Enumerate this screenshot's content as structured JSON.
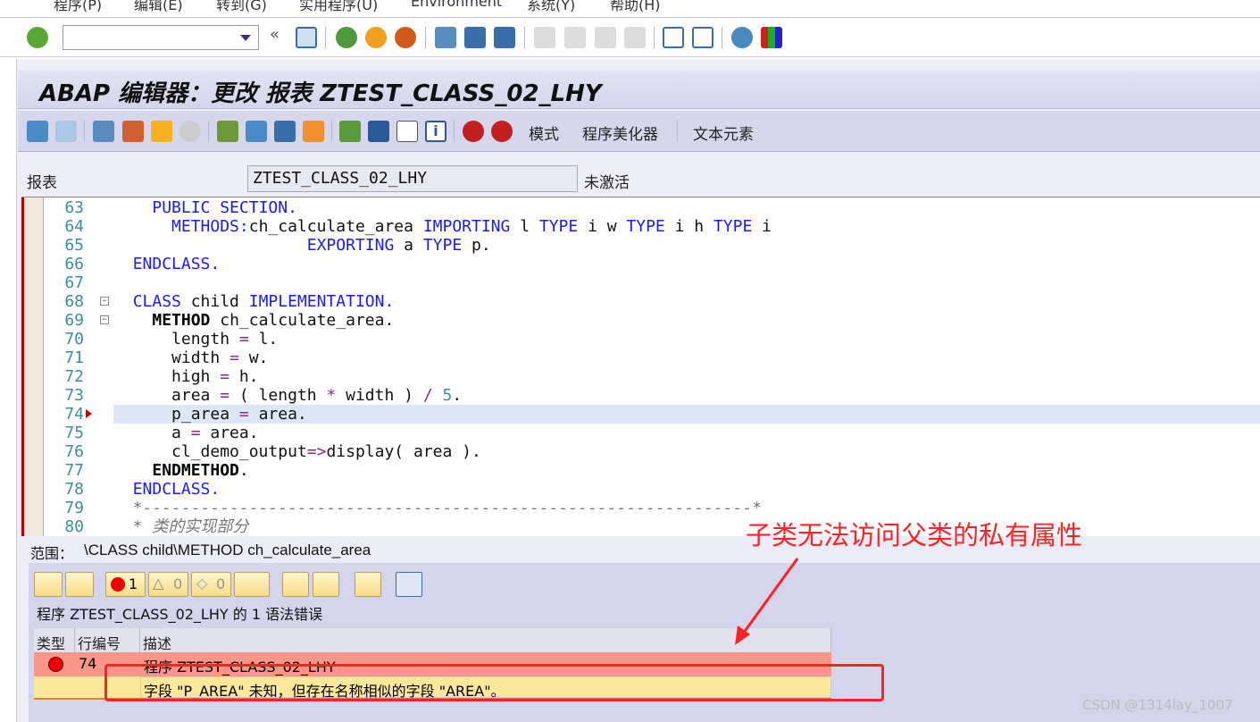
{
  "menu": [
    "程序(P)",
    "编辑(E)",
    "转到(G)",
    "实用程序(U)",
    "Environment",
    "系统(Y)",
    "帮助(H)"
  ],
  "toolbar": {
    "command_value": "",
    "icons": [
      "check-icon",
      "save-icon",
      "back-icon",
      "exit-icon",
      "cancel-icon",
      "print-icon",
      "find-icon",
      "find-next-icon",
      "first-page-icon",
      "prev-page-icon",
      "next-page-icon",
      "last-page-icon",
      "new-session-icon",
      "shortcut-icon",
      "help-icon",
      "layout-icon"
    ]
  },
  "title": "ABAP 编辑器：更改 报表 ZTEST_CLASS_02_LHY",
  "app_toolbar": {
    "mode": "模式",
    "pretty_printer": "程序美化器",
    "text_elements": "文本元素"
  },
  "report": {
    "label": "报表",
    "value": "ZTEST_CLASS_02_LHY",
    "status": "未激活"
  },
  "code": [
    {
      "n": "63",
      "t": [
        [
          "    ",
          ""
        ],
        [
          "PUBLIC SECTION",
          "kw"
        ],
        [
          ".",
          "kw"
        ]
      ]
    },
    {
      "n": "64",
      "t": [
        [
          "      ",
          ""
        ],
        [
          "METHODS",
          "kw"
        ],
        [
          ":",
          "kw"
        ],
        [
          "ch_calculate_area ",
          ""
        ],
        [
          "IMPORTING",
          "kw"
        ],
        [
          " l ",
          ""
        ],
        [
          "TYPE",
          "kw"
        ],
        [
          " i w ",
          ""
        ],
        [
          "TYPE",
          "kw"
        ],
        [
          " i h ",
          ""
        ],
        [
          "TYPE",
          "kw"
        ],
        [
          " i",
          ""
        ]
      ]
    },
    {
      "n": "65",
      "t": [
        [
          "                    ",
          ""
        ],
        [
          "EXPORTING",
          "kw"
        ],
        [
          " a ",
          ""
        ],
        [
          "TYPE",
          "kw"
        ],
        [
          " p.",
          ""
        ]
      ]
    },
    {
      "n": "66",
      "t": [
        [
          "  ",
          ""
        ],
        [
          "ENDCLASS",
          "kw"
        ],
        [
          ".",
          "kw"
        ]
      ]
    },
    {
      "n": "67",
      "t": []
    },
    {
      "n": "68",
      "t": [
        [
          "  ",
          ""
        ],
        [
          "CLASS",
          "kw"
        ],
        [
          " child ",
          ""
        ],
        [
          "IMPLEMENTATION",
          "kw"
        ],
        [
          ".",
          "kw"
        ]
      ]
    },
    {
      "n": "69",
      "t": [
        [
          "    ",
          ""
        ],
        [
          "METHOD",
          "kwb"
        ],
        [
          " ch_calculate_area.",
          ""
        ]
      ]
    },
    {
      "n": "70",
      "t": [
        [
          "      length ",
          ""
        ],
        [
          "=",
          "op"
        ],
        [
          " l.",
          ""
        ]
      ]
    },
    {
      "n": "71",
      "t": [
        [
          "      width ",
          ""
        ],
        [
          "=",
          "op"
        ],
        [
          " w.",
          ""
        ]
      ]
    },
    {
      "n": "72",
      "t": [
        [
          "      high ",
          ""
        ],
        [
          "=",
          "op"
        ],
        [
          " h.",
          ""
        ]
      ]
    },
    {
      "n": "73",
      "t": [
        [
          "      area ",
          ""
        ],
        [
          "=",
          "op"
        ],
        [
          " ( length ",
          ""
        ],
        [
          "*",
          "op"
        ],
        [
          " width ) ",
          ""
        ],
        [
          "/",
          "op"
        ],
        [
          " ",
          ""
        ],
        [
          "5",
          "num2"
        ],
        [
          ".",
          ""
        ]
      ]
    },
    {
      "n": "74",
      "t": [
        [
          "      p_area ",
          ""
        ],
        [
          "=",
          "op"
        ],
        [
          " area.",
          ""
        ]
      ]
    },
    {
      "n": "75",
      "t": [
        [
          "      a ",
          ""
        ],
        [
          "=",
          "op"
        ],
        [
          " area.",
          ""
        ]
      ]
    },
    {
      "n": "76",
      "t": [
        [
          "      cl_demo_output",
          ""
        ],
        [
          "=>",
          "op"
        ],
        [
          "display( area ).",
          ""
        ]
      ]
    },
    {
      "n": "77",
      "t": [
        [
          "    ",
          ""
        ],
        [
          "ENDMETHOD",
          "kwb"
        ],
        [
          ".",
          ""
        ]
      ]
    },
    {
      "n": "78",
      "t": [
        [
          "  ",
          ""
        ],
        [
          "ENDCLASS",
          "kw"
        ],
        [
          ".",
          "kw"
        ]
      ]
    },
    {
      "n": "79",
      "t": [
        [
          "  *---------------------------------------------------------------*",
          "cm"
        ]
      ]
    },
    {
      "n": "80",
      "t": [
        [
          "  * 类的实现部分",
          "cm"
        ]
      ]
    }
  ],
  "scope": {
    "label": "范围：",
    "value": "\\CLASS child\\METHOD ch_calculate_area"
  },
  "errors": {
    "error_count": "1",
    "warning_count": "0",
    "info_count": "0",
    "summary": "程序 ZTEST_CLASS_02_LHY 的 1 语法错误",
    "headers": [
      "类型",
      "行编号",
      "描述"
    ],
    "row": {
      "line": "74",
      "program": "程序 ZTEST_CLASS_02_LHY",
      "message": "字段 \"P_AREA\" 未知，但存在名称相似的字段 \"AREA\"。"
    }
  },
  "annotation": "子类无法访问父类的私有属性",
  "watermark": "CSDN @1314lay_1007",
  "colors": {
    "error_row": "#f9968a",
    "message_row": "#fbe89a",
    "annotation": "#ff2222",
    "title_bar": "#d4d4ec"
  }
}
